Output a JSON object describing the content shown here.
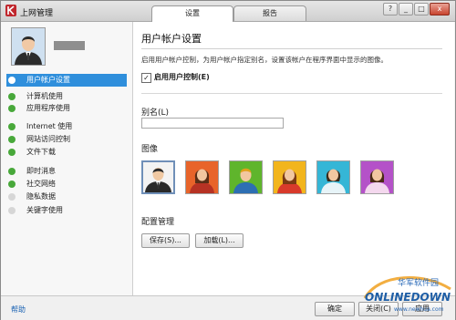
{
  "window": {
    "title": "上网管理"
  },
  "tabs": [
    {
      "label": "设置",
      "active": true
    },
    {
      "label": "报告",
      "active": false
    }
  ],
  "window_controls": {
    "help": "?",
    "minimize": "_",
    "maximize": "□",
    "close": "x"
  },
  "sidebar": {
    "items": [
      {
        "label": "用户帐户设置",
        "selected": true,
        "status": "green"
      },
      {
        "label": "计算机使用",
        "status": "green"
      },
      {
        "label": "应用程序使用",
        "status": "green"
      },
      {
        "label": "Internet 使用",
        "status": "green"
      },
      {
        "label": "网站访问控制",
        "status": "green"
      },
      {
        "label": "文件下载",
        "status": "green"
      },
      {
        "label": "即时消息",
        "status": "green"
      },
      {
        "label": "社交网络",
        "status": "green"
      },
      {
        "label": "隐私数据",
        "status": "gray"
      },
      {
        "label": "关键字使用",
        "status": "gray"
      }
    ]
  },
  "main": {
    "title": "用户帐户设置",
    "description": "启用用户帐户控制，为用户帐户指定别名，设置该帐户在程序界面中显示的图像。",
    "enable_checkbox": {
      "label": "启用用户控制(E)",
      "checked": true
    },
    "alias": {
      "label": "别名(L)",
      "value": ""
    },
    "image_label": "图像",
    "images": [
      {
        "name": "man-suit",
        "selected": true
      },
      {
        "name": "woman-red"
      },
      {
        "name": "boy-green"
      },
      {
        "name": "girl-yellow"
      },
      {
        "name": "girl-cyan"
      },
      {
        "name": "woman-purple"
      }
    ],
    "manage_label": "配置管理",
    "save_button": "保存(S)...",
    "load_button": "加载(L)..."
  },
  "footer": {
    "help": "帮助",
    "ok": "确定",
    "close": "关闭(C)",
    "apply": "应用"
  },
  "watermark": {
    "line1": "华军软件园",
    "line2": "ONLINEDOWN",
    "line3": "www.newhua.com"
  },
  "colors": {
    "accent": "#2f8fdc",
    "status_green": "#48a83a",
    "status_gray": "#d6d6d6"
  }
}
